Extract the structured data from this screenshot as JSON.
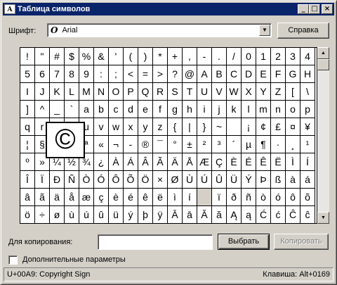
{
  "window": {
    "title": "Таблица символов",
    "icon": "charmap-icon",
    "controls": {
      "minimize": "_",
      "maximize": "□",
      "close": "×"
    }
  },
  "font_row": {
    "label": "Шрифт:",
    "selected_font": "Arial",
    "font_icon": "O",
    "help_button": "Справка"
  },
  "grid": {
    "rows": [
      [
        "!",
        "\"",
        "#",
        "$",
        "%",
        "&",
        "'",
        "(",
        ")",
        "*",
        "+",
        ",",
        "-",
        ".",
        "/",
        "0",
        "1",
        "2",
        "3",
        "4"
      ],
      [
        "5",
        "6",
        "7",
        "8",
        "9",
        ":",
        ";",
        "<",
        "=",
        ">",
        "?",
        "@",
        "A",
        "B",
        "C",
        "D",
        "E",
        "F",
        "G",
        "H"
      ],
      [
        "I",
        "J",
        "K",
        "L",
        "M",
        "N",
        "O",
        "P",
        "Q",
        "R",
        "S",
        "T",
        "U",
        "V",
        "W",
        "X",
        "Y",
        "Z",
        "[",
        "\\"
      ],
      [
        "]",
        "^",
        "_",
        "`",
        "a",
        "b",
        "c",
        "d",
        "e",
        "f",
        "g",
        "h",
        "i",
        "j",
        "k",
        "l",
        "m",
        "n",
        "o",
        "p"
      ],
      [
        "q",
        "r",
        "s",
        "t",
        "u",
        "v",
        "w",
        "x",
        "y",
        "z",
        "{",
        "|",
        "}",
        "~",
        " ",
        "¡",
        "¢",
        "£",
        "¤",
        "¥"
      ],
      [
        "¦",
        "§",
        "¨",
        "©",
        "ª",
        "«",
        "¬",
        "-",
        "®",
        "¯",
        "°",
        "±",
        "²",
        "³",
        "´",
        "µ",
        "¶",
        "·",
        "¸",
        "¹"
      ],
      [
        "º",
        "»",
        "¼",
        "½",
        "¾",
        "¿",
        "À",
        "Á",
        "Â",
        "Ã",
        "Ä",
        "Å",
        "Æ",
        "Ç",
        "È",
        "É",
        "Ê",
        "Ë",
        "Ì",
        "Í"
      ],
      [
        "Î",
        "Ï",
        "Ð",
        "Ñ",
        "Ò",
        "Ó",
        "Ô",
        "Õ",
        "Ö",
        "×",
        "Ø",
        "Ù",
        "Ú",
        "Û",
        "Ü",
        "Ý",
        "Þ",
        "ß",
        "à",
        "á"
      ],
      [
        "â",
        "ã",
        "ä",
        "å",
        "æ",
        "ç",
        "è",
        "é",
        "ê",
        "ë",
        "ì",
        "í",
        "",
        "ï",
        "ð",
        "ñ",
        "ò",
        "ó",
        "ô",
        "õ"
      ],
      [
        "ö",
        "÷",
        "ø",
        "ù",
        "ú",
        "û",
        "ü",
        "ý",
        "þ",
        "ÿ",
        "Ā",
        "ā",
        "Ă",
        "ă",
        "Ą",
        "ą",
        "Ć",
        "ć",
        "Ĉ",
        "ĉ"
      ]
    ],
    "selected_char": "©",
    "grayed_cell": {
      "row": 8,
      "col": 12
    }
  },
  "copy_row": {
    "label": "Для копирования:",
    "value": "",
    "select_button": "Выбрать",
    "copy_button": "Копировать"
  },
  "advanced": {
    "label": "Дополнительные параметры",
    "checked": false
  },
  "status": {
    "char_info": "U+00A9: Copyright Sign",
    "keystroke": "Клавиша: Alt+0169"
  }
}
